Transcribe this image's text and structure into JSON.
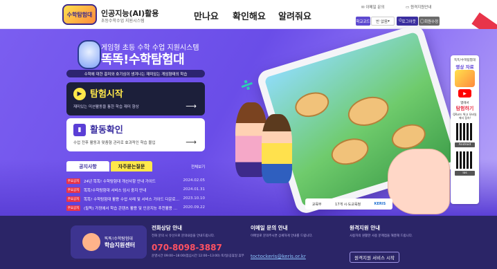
{
  "header": {
    "logo_text": "수학탐험대",
    "brand_title": "인공지능(AI)활용",
    "brand_sub": "초등수학수업 지원시스템",
    "nav": [
      "만나요",
      "확인해요",
      "알려줘요"
    ],
    "util_links": [
      "이메일 문의",
      "원격지원안내"
    ],
    "login_pills": [
      "학교코드",
      "반 없음",
      "로그아웃",
      "회원수정"
    ]
  },
  "hero": {
    "subtitle": "게임형 초등 수학 수업 지원시스템",
    "title": "똑똑!수학탐험대",
    "tagline": "수학에 대한 흥미와 호기심이 생겨나는 재미있는 게임형태의 학습",
    "cards": [
      {
        "title": "탐험시작",
        "desc": "재미있는 미션활동을 통한 학습 재미 향상",
        "icon": "play-icon"
      },
      {
        "title": "활동확인",
        "desc": "수업 전후 활동과 맞춤형 관리로 효과적인 학습 몰입",
        "icon": "bar-chart-icon"
      }
    ]
  },
  "notice": {
    "tabs": [
      "공지사항",
      "자주묻는질문"
    ],
    "more": "전체보기",
    "badge": "주요공지",
    "items": [
      {
        "text": "24년 똑똑! 수학탐험대 개선사항 안내 가이드",
        "date": "2024.02.05"
      },
      {
        "text": "똑똑!수학탐험대 서비스 임시 중지 안내",
        "date": "2024.01.31"
      },
      {
        "text": "똑똑! 수학탐험대 활용 수업 사례 및 서비스 가이드 다운로…",
        "date": "2023.10.10"
      },
      {
        "text": "(필독) 가정에서 학습 콘텐츠 활용 및 인공지능 추천활용 …",
        "date": "2020.09.22"
      }
    ]
  },
  "partners": [
    "교육부",
    "17개 시·도교육청",
    "KERIS"
  ],
  "side_banner": {
    "title1": "똑똑!수학탐험대",
    "title2": "영상 자료",
    "promo1": "앱에서",
    "promo2": "탐험하기",
    "qr_caption": "QR코드 찍고 모바일에서 접속!",
    "android": "Android",
    "ios": "ios"
  },
  "footer": {
    "logo_text1": "똑똑!수학탐험대",
    "logo_text2": "학습지원센터",
    "phone_title": "전화상담 안내",
    "phone_desc": "전화 문의 시 유선으로 문의내용을 안내드립니다.",
    "phone": "070-8098-3887",
    "hours": "운영시간 09:00~18:00(점심시간 12:00~13:00) 토/일/공휴일 휴무",
    "email_title": "이메일 문의 안내",
    "email_desc": "이메일로 문의주시면 상세하게 안내를 드립니다.",
    "email": "toctockeris@keris.or.kr",
    "remote_title": "원격지원 안내",
    "remote_desc": "사용자의 원활한 사용 문제점을 해결해 드립니다.",
    "remote_button": "원격지원 서비스 시작"
  },
  "colors": {
    "hero": "#7b5ef0",
    "footer": "#2b2567",
    "accent_yellow": "#ffe84a",
    "badge_red": "#e8344a"
  }
}
